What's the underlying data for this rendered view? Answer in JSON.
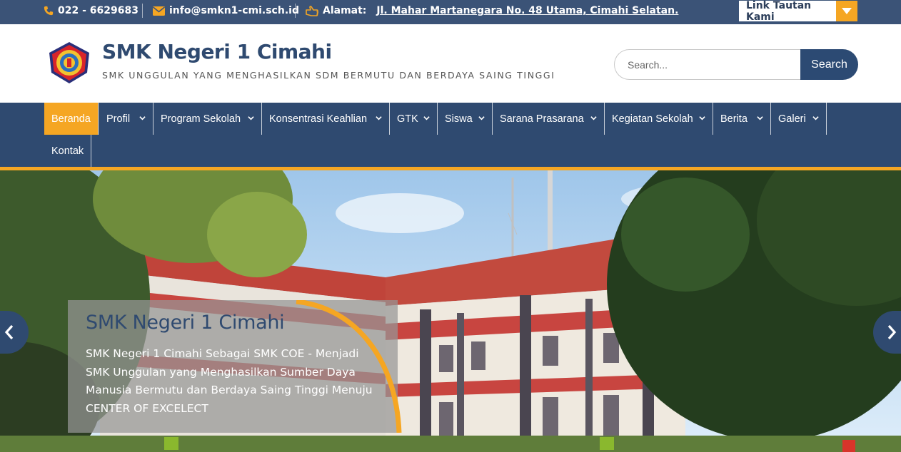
{
  "topbar": {
    "phone": "022 - 6629683",
    "email": "info@smkn1-cmi.sch.id",
    "address_label": "Alamat:",
    "address": "Jl. Mahar Martanegara No. 48 Utama, Cimahi Selatan.",
    "link_dropdown": "Link Tautan Kami"
  },
  "header": {
    "title": "SMK Negeri 1 Cimahi",
    "tagline": "SMK UNGGULAN YANG MENGHASILKAN SDM BERMUTU DAN BERDAYA SAING TINGGI",
    "search_placeholder": "Search...",
    "search_button": "Search"
  },
  "nav": {
    "items": [
      {
        "label": "Beranda"
      },
      {
        "label": "Profil"
      },
      {
        "label": "Program Sekolah"
      },
      {
        "label": "Konsentrasi Keahlian"
      },
      {
        "label": "GTK"
      },
      {
        "label": "Siswa"
      },
      {
        "label": "Sarana Prasarana"
      },
      {
        "label": "Kegiatan Sekolah"
      },
      {
        "label": "Berita"
      },
      {
        "label": "Galeri"
      },
      {
        "label": "Kontak"
      }
    ]
  },
  "slider": {
    "title": "SMK Negeri 1 Cimahi",
    "text": "SMK Negeri 1 Cimahi Sebagai SMK COE - Menjadi SMK Unggulan yang Menghasilkan Sumber Daya Manusia Bermutu dan Berdaya Saing Tinggi Menuju CENTER OF EXCELECT"
  },
  "colors": {
    "primary": "#2f4a70",
    "accent": "#f5a623",
    "topbar": "#3b5377"
  },
  "icons": {
    "phone": "phone-icon",
    "email": "envelope-icon",
    "address": "hand-pointer-icon",
    "dropdown": "caret-down-icon",
    "prev": "chevron-left-icon",
    "next": "chevron-right-icon"
  }
}
